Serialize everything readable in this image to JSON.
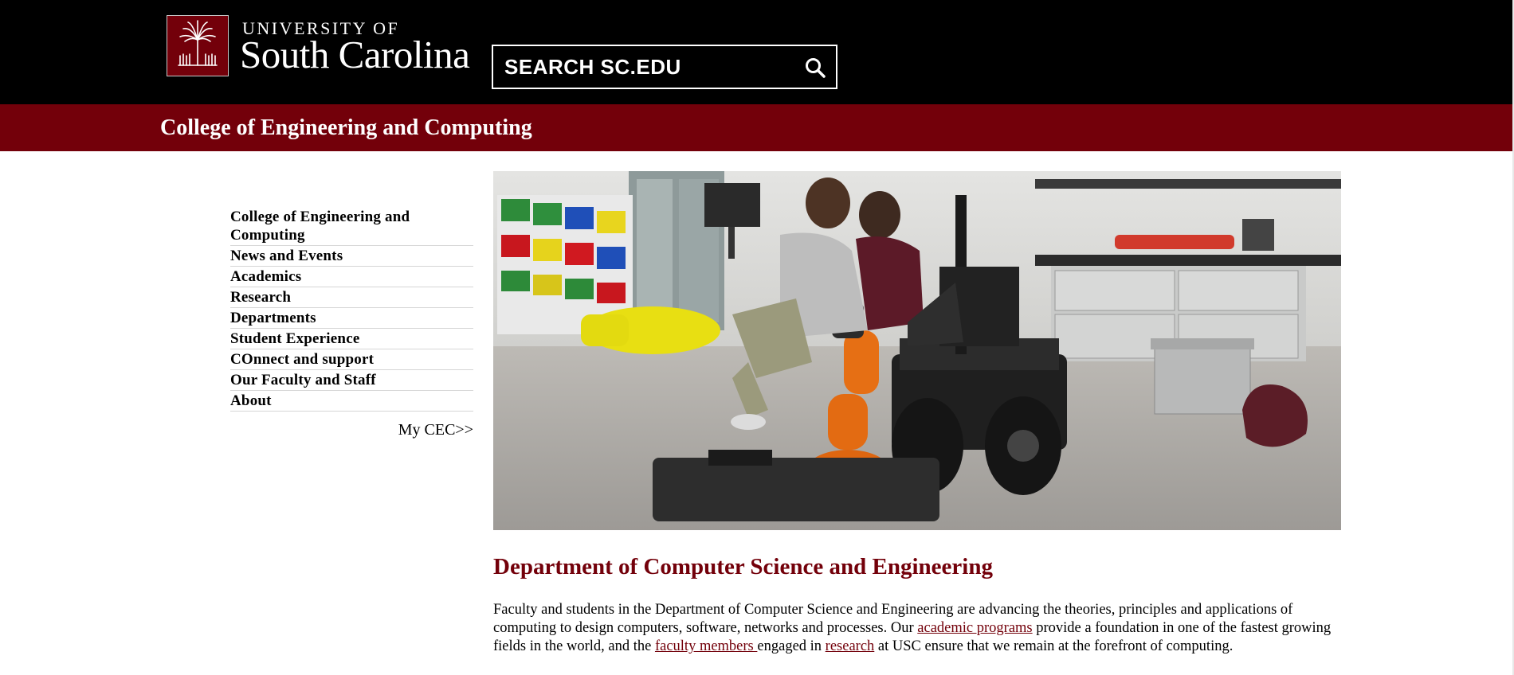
{
  "header": {
    "logo_line1": "UNIVERSITY OF",
    "logo_line2": "South Carolina",
    "search_placeholder": "SEARCH SC.EDU",
    "search_icon": "magnifier-icon",
    "logo_icon": "palmetto-tree-icon"
  },
  "college_bar": {
    "title": "College of Engineering and Computing"
  },
  "nav": {
    "items": [
      "College of Engineering and Computing",
      "News and Events",
      "Academics",
      "Research",
      "Departments",
      "Student Experience",
      "COnnect and support",
      "Our Faculty and Staff",
      "About"
    ],
    "my_cec": "My CEC>>"
  },
  "main": {
    "title": "Department of Computer Science and Engineering",
    "intro": {
      "part1": "Faculty and students in the Department of Computer Science and Engineering are advancing the theories, principles and applications of computing to design computers, software, networks and processes. Our ",
      "link_programs": "academic programs",
      "part2": " provide a foundation in one of the fastest growing fields in the world, and the ",
      "link_faculty": "faculty members ",
      "part3": "engaged in ",
      "link_research": "research",
      "part4": " at USC ensure that we remain at the forefront of computing."
    }
  },
  "colors": {
    "garnet": "#73000a",
    "black": "#000000",
    "white": "#ffffff"
  }
}
